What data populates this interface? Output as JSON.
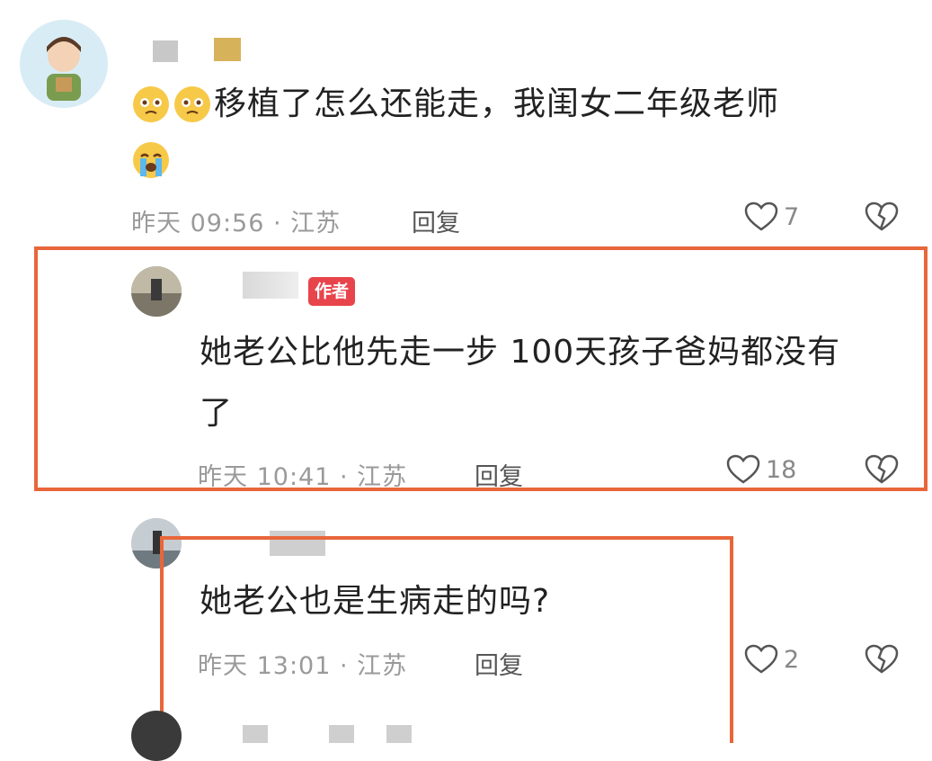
{
  "comments": [
    {
      "text_prefix_emojis": [
        "crying-face-emoji",
        "crying-face-emoji"
      ],
      "text": "移植了怎么还能走，我闺女二年级老师",
      "text_suffix_emoji": "loudly-crying-face-emoji",
      "time": "昨天 09:56 · 江苏",
      "reply_label": "回复",
      "likes": "7"
    },
    {
      "badge": "作者",
      "text_line1": "她老公比他先走一步 100天孩子爸妈都没有",
      "text_line2": "了",
      "time": "昨天 10:41 · 江苏",
      "reply_label": "回复",
      "likes": "18"
    },
    {
      "text": "她老公也是生病走的吗?",
      "time": "昨天 13:01 · 江苏",
      "reply_label": "回复",
      "likes": "2"
    }
  ],
  "colors": {
    "highlight": "#e8663a",
    "author_badge": "#e8444b"
  },
  "icons": {
    "like": "heart-outline-icon",
    "dislike": "broken-heart-icon"
  }
}
